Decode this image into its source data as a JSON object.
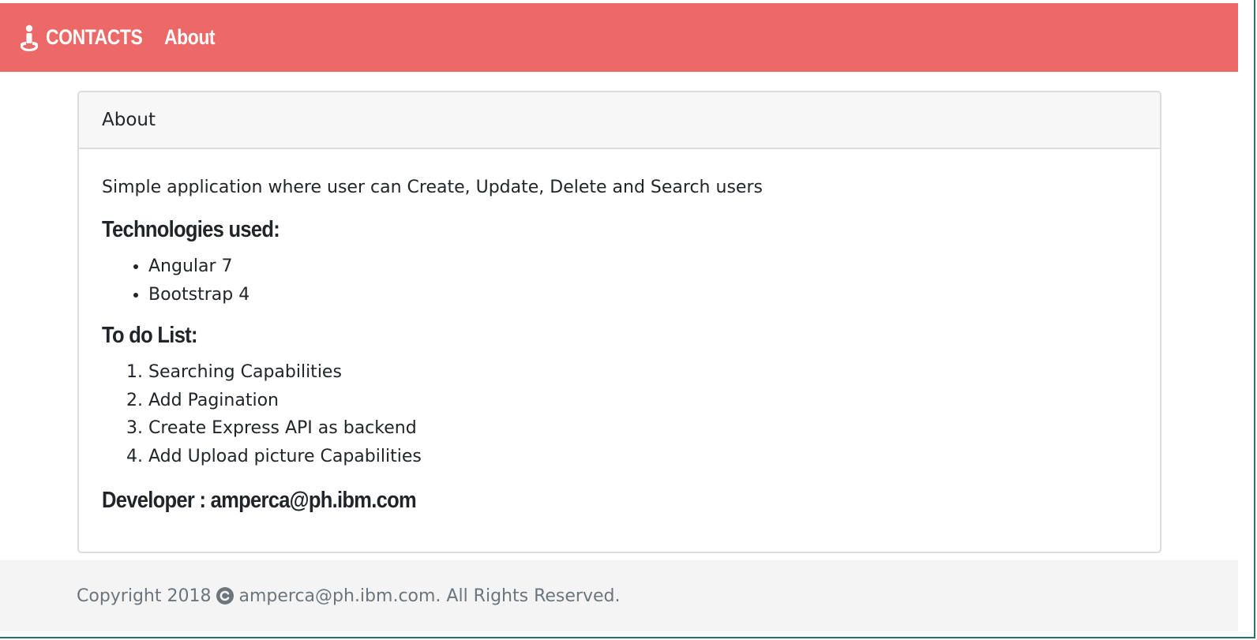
{
  "navbar": {
    "brand_icon": "person-standing-icon",
    "brand_label": "CONTACTS",
    "about_link": "About",
    "background": "#ec6967"
  },
  "card": {
    "header_title": "About",
    "description": "Simple application where user can Create, Update, Delete and Search users",
    "technologies_heading": "Technologies used:",
    "technologies": [
      "Angular 7",
      "Bootstrap 4"
    ],
    "todo_heading": "To do List:",
    "todo_items": [
      "Searching Capabilities",
      "Add Pagination",
      "Create Express API as backend",
      "Add Upload picture Capabilities"
    ],
    "developer_line": "Developer : amperca@ph.ibm.com"
  },
  "footer": {
    "copyright_prefix": "Copyright 2018",
    "copyright_icon": "copyright-icon",
    "copyright_suffix": "amperca@ph.ibm.com. All Rights Reserved."
  }
}
